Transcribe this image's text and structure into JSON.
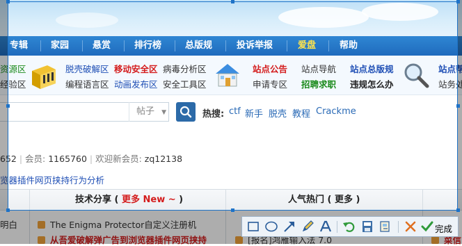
{
  "nav": {
    "items": [
      {
        "label": "专辑",
        "hot": false
      },
      {
        "label": "家园",
        "hot": false
      },
      {
        "label": "悬赏",
        "hot": false
      },
      {
        "label": "排行榜",
        "hot": false
      },
      {
        "label": "总版规",
        "hot": false
      },
      {
        "label": "投诉举报",
        "hot": false
      },
      {
        "label": "爱盘",
        "hot": true
      },
      {
        "label": "帮助",
        "hot": false
      }
    ]
  },
  "quick_links": {
    "left_partial": [
      "资源区",
      "经验区"
    ],
    "col1": [
      "脱壳破解区",
      "编程语言区"
    ],
    "col2": [
      "移动安全区",
      "动画发布区"
    ],
    "col3": [
      "病毒分析区",
      "安全工具区"
    ],
    "col4": [
      "站点公告",
      "申请专区"
    ],
    "col5": [
      "站点导航",
      "招聘求职"
    ],
    "col6": [
      "站点总版规",
      "违规怎么办"
    ],
    "right_partial": [
      "站点帮",
      "站务处"
    ]
  },
  "search": {
    "select_value": "帖子",
    "hot_label": "热搜:",
    "hot_terms": [
      "ctf",
      "新手",
      "脱壳",
      "教程",
      "Crackme"
    ]
  },
  "stats": {
    "partial_number": "652",
    "members_label": "会员:",
    "members_value": "1165760",
    "welcome_label": "欢迎新会员:",
    "new_member": "zq12138"
  },
  "notice": "览器插件网页挟持行为分析",
  "table": {
    "col1_prefix": "技术分享 ( ",
    "col1_more": "更多 New ~",
    "col1_suffix": " )",
    "col2_header": "人气热门 ( 更多 )",
    "left_partial_rows": [
      "明白"
    ],
    "rows": [
      {
        "text": "The Enigma Protector自定义注册机",
        "highlight": false
      },
      {
        "text": "从吾爱破解弹广告到浏览器插件网页挟持",
        "highlight": true
      }
    ],
    "col2_partial_rows": [
      "[报名]鸿雁输入法 7.0"
    ],
    "right_partial_rows": [
      "菜信"
    ]
  },
  "capture_toolbar": {
    "tools": [
      "rectangle-tool",
      "ellipse-tool",
      "arrow-tool",
      "pen-tool",
      "text-tool",
      "undo-tool",
      "save-tool",
      "copy-tool",
      "cancel-tool",
      "done-tool"
    ],
    "done_label": "完成"
  },
  "colors": {
    "nav_bg": "#1f6bbd",
    "selection_border": "#1e73c8",
    "link_blue": "#1f4fb5",
    "alert_red": "#d41c1c"
  }
}
